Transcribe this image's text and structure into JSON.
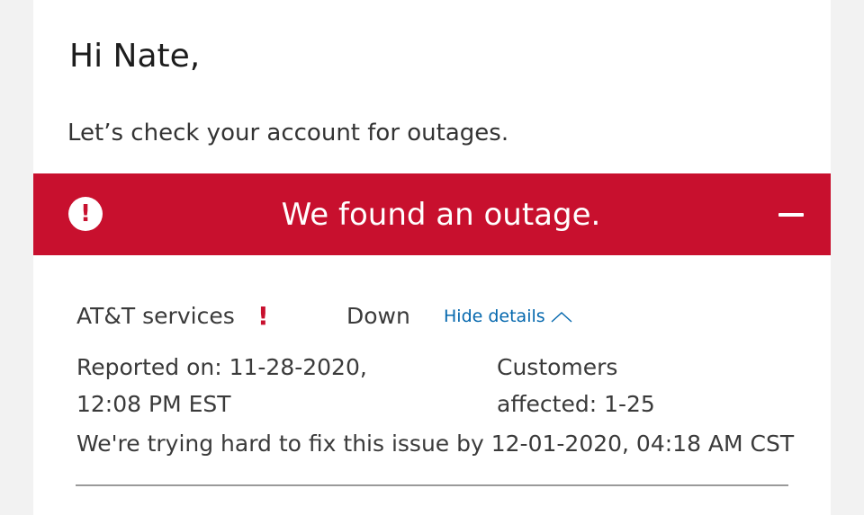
{
  "greeting": "Hi Nate,",
  "subtitle": "Let’s check your account for outages.",
  "banner": {
    "title": "We found an outage.",
    "alert_icon": "exclamation-circle-icon",
    "collapse_icon": "minus-icon",
    "color": "#c8102e"
  },
  "outage": {
    "service_label": "AT&T services",
    "service_icon": "!",
    "status": "Down",
    "toggle_label": "Hide details",
    "toggle_icon": "chevron-up-icon",
    "toggle_color": "#0568ae",
    "reported_label": "Reported on: 11-28-2020,",
    "reported_time": "12:08 PM EST",
    "customers_label": "Customers",
    "customers_value": "affected: 1-25",
    "fix_message": "We're trying hard to fix this issue by 12-01-2020, 04:18 AM CST"
  }
}
